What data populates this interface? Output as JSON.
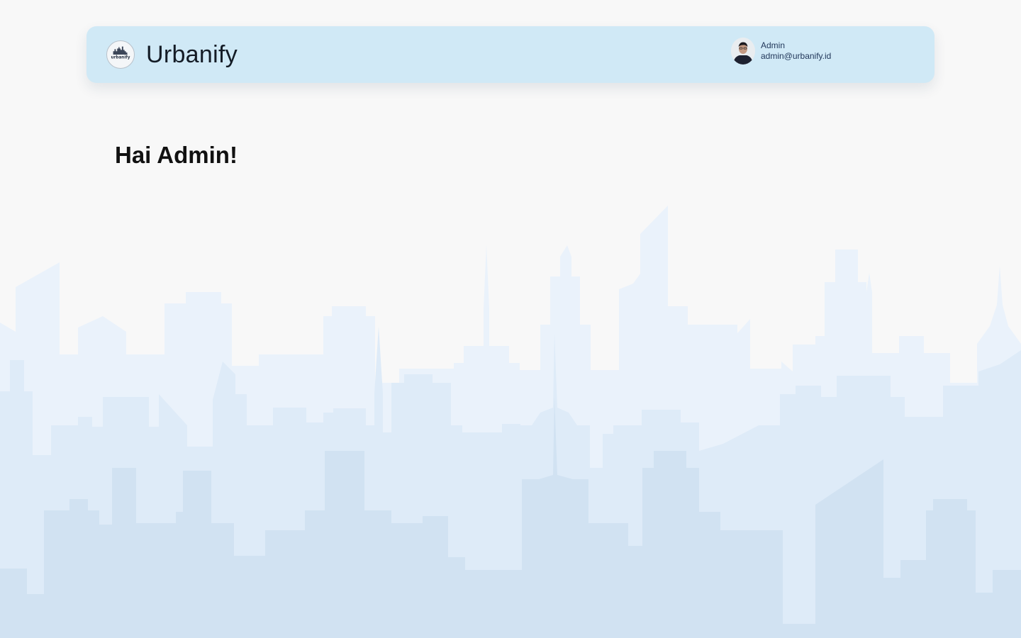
{
  "header": {
    "app_name": "Urbanify",
    "logo_text": "urbanify",
    "logo_icon": "city-skyline-logo-icon",
    "user": {
      "name": "Admin",
      "email": "admin@urbanify.id",
      "avatar_icon": "user-avatar-icon"
    }
  },
  "main": {
    "greeting": "Hai Admin!"
  },
  "colors": {
    "background": "#f8f8f8",
    "navbar": "#d0e9f6",
    "skyline_back": "#eaf2fb",
    "skyline_mid": "#deebf8",
    "skyline_front": "#d1e2f2",
    "text_primary": "#111111",
    "user_text": "#1f3558"
  }
}
